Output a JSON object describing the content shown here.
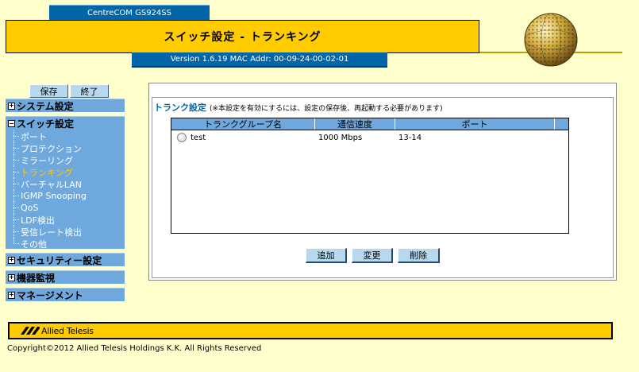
{
  "header": {
    "model": "CentreCOM GS924SS",
    "title": "スイッチ設定 - トランキング",
    "version": "Version 1.6.19 MAC Addr: 00-09-24-00-02-01"
  },
  "sidebar": {
    "save_label": "保存",
    "exit_label": "終了",
    "system": "システム設定",
    "switch": "スイッチ設定",
    "switch_items": [
      "ポート",
      "プロテクション",
      "ミラーリング",
      "トランキング",
      "バーチャルLAN",
      "IGMP Snooping",
      "QoS",
      "LDF検出",
      "受信レート検出",
      "その他"
    ],
    "active_index": 3,
    "security": "セキュリティー設定",
    "monitor": "機器監視",
    "management": "マネージメント"
  },
  "main": {
    "section_title": "トランク設定",
    "section_note": "(※本設定を有効にするには、設定の保存後、再起動する必要があります)",
    "table": {
      "headers": [
        "トランクグループ名",
        "通信速度",
        "ポート"
      ],
      "rows": [
        {
          "name": "test",
          "speed": "1000 Mbps",
          "ports": "13-14"
        }
      ]
    },
    "add_label": "追加",
    "change_label": "変更",
    "delete_label": "削除"
  },
  "footer": {
    "brand": "Allied Telesis",
    "copyright": "Copyright©2012 Allied Telesis Holdings K.K. All Rights Reserved"
  },
  "colors": {
    "background": "#ffffcc",
    "accent_yellow": "#ffcc00",
    "header_blue": "#0066a8",
    "sidebar_blue": "#6fa8dc",
    "active_item": "#ffcc00"
  }
}
